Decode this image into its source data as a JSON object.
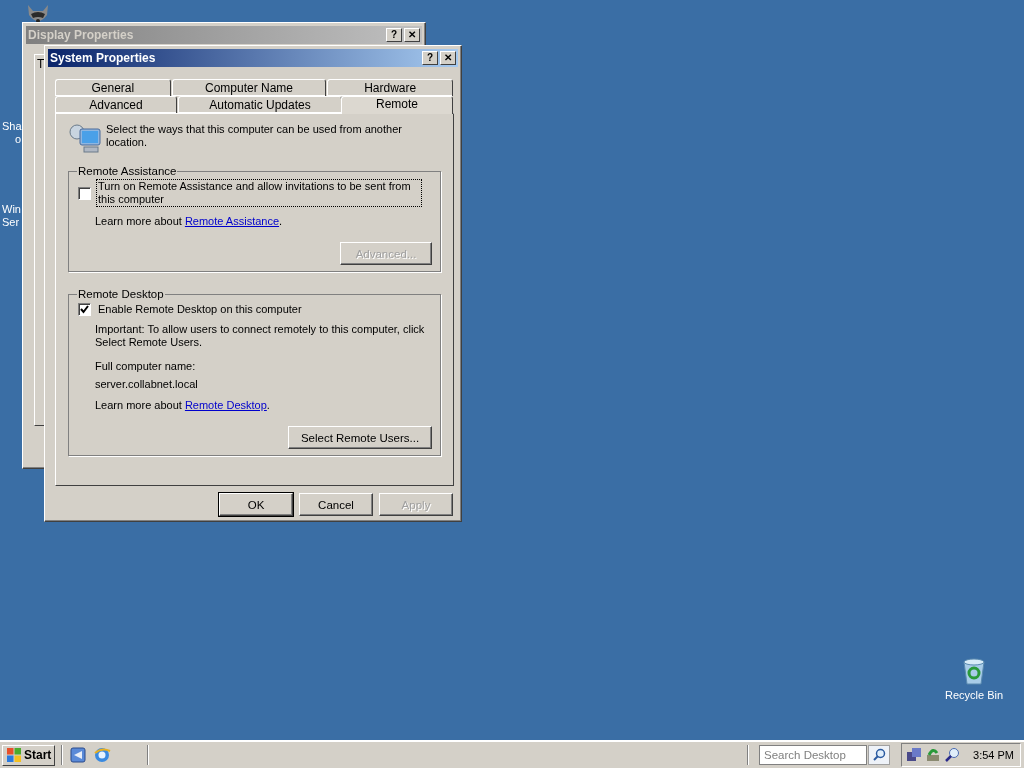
{
  "desktop": {
    "icons": [
      {
        "lines": [
          "Sha",
          "o"
        ]
      },
      {
        "lines": [
          "Win",
          "Ser"
        ]
      }
    ],
    "recycle_bin": {
      "label": "Recycle Bin"
    }
  },
  "back_window": {
    "title": "Display Properties",
    "active": false,
    "title_buttons": [
      "?",
      "✕"
    ],
    "tab_label": "T"
  },
  "window": {
    "title": "System Properties",
    "active": true,
    "title_buttons": [
      "?",
      "✕"
    ],
    "tab_rows": [
      [
        {
          "label": "General",
          "selected": false
        },
        {
          "label": "Computer Name",
          "selected": false
        },
        {
          "label": "Hardware",
          "selected": false
        }
      ],
      [
        {
          "label": "Advanced",
          "selected": false
        },
        {
          "label": "Automatic Updates",
          "selected": false
        },
        {
          "label": "Remote",
          "selected": true
        }
      ]
    ],
    "intro": "Select the ways that this computer can be used from another location.",
    "remote_assistance": {
      "title": "Remote Assistance",
      "checkbox": {
        "label": "Turn on Remote Assistance and allow invitations to be sent from this computer",
        "checked": false,
        "focused": true
      },
      "learn_more": {
        "prefix": "Learn more about ",
        "link": "Remote Assistance",
        "suffix": "."
      },
      "button": {
        "label": "Advanced...",
        "disabled": true
      }
    },
    "remote_desktop": {
      "title": "Remote Desktop",
      "checkbox": {
        "label": "Enable Remote Desktop on this computer",
        "checked": true,
        "focused": false
      },
      "note": "Important: To allow users to connect remotely to this computer, click Select Remote Users.",
      "name_label": "Full computer name:",
      "name_value": "server.collabnet.local",
      "learn_more": {
        "prefix": "Learn more about ",
        "link": "Remote Desktop",
        "suffix": "."
      },
      "button": {
        "label": "Select Remote Users...",
        "disabled": false
      }
    },
    "buttons": [
      {
        "label": "OK",
        "disabled": false,
        "default": true
      },
      {
        "label": "Cancel",
        "disabled": false,
        "default": false
      },
      {
        "label": "Apply",
        "disabled": true,
        "default": false
      }
    ]
  },
  "taskbar": {
    "start": "Start",
    "search": {
      "placeholder": "Search Desktop"
    },
    "clock": "3:54 PM"
  }
}
